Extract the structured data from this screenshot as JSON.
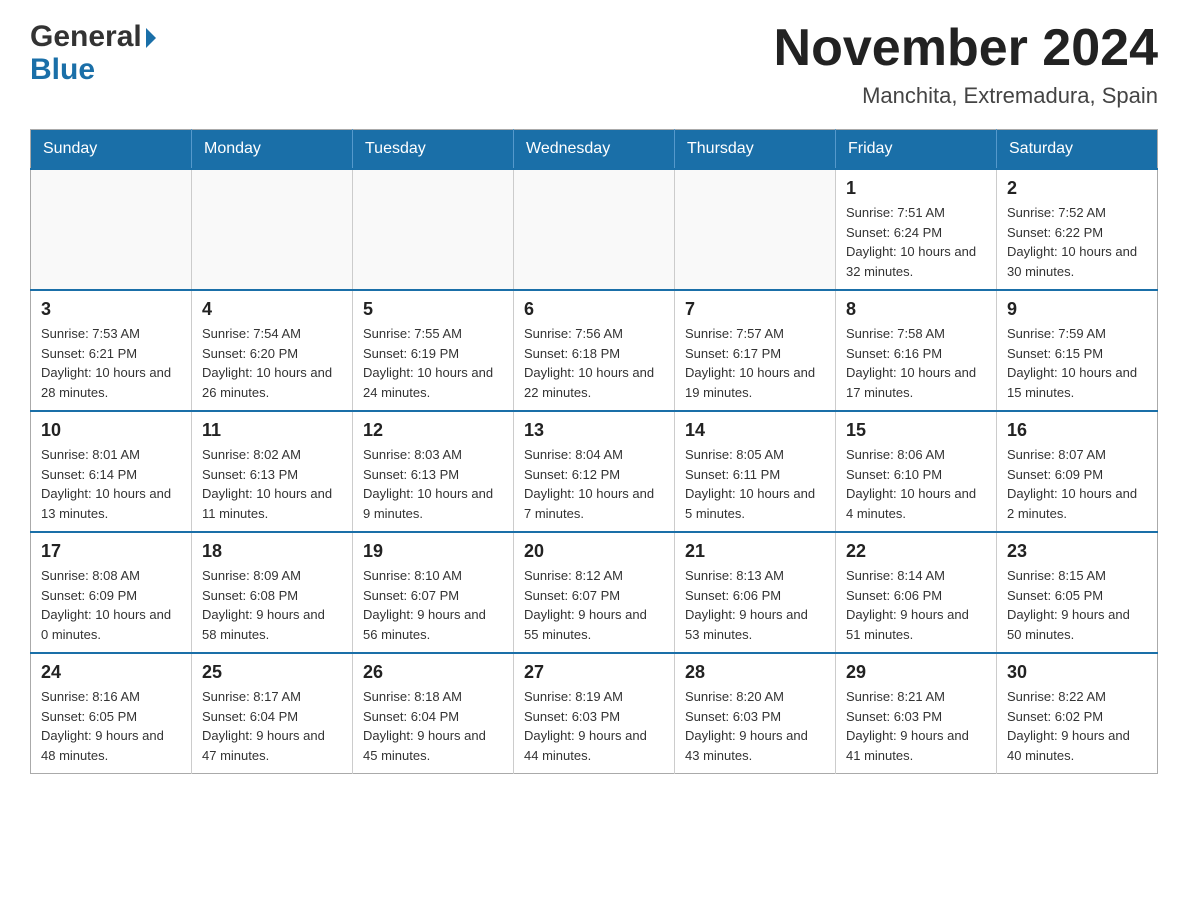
{
  "logo": {
    "general": "General",
    "blue": "Blue",
    "arrow": "▶"
  },
  "header": {
    "title": "November 2024",
    "subtitle": "Manchita, Extremadura, Spain"
  },
  "weekdays": [
    "Sunday",
    "Monday",
    "Tuesday",
    "Wednesday",
    "Thursday",
    "Friday",
    "Saturday"
  ],
  "weeks": [
    [
      {
        "day": "",
        "info": ""
      },
      {
        "day": "",
        "info": ""
      },
      {
        "day": "",
        "info": ""
      },
      {
        "day": "",
        "info": ""
      },
      {
        "day": "",
        "info": ""
      },
      {
        "day": "1",
        "info": "Sunrise: 7:51 AM\nSunset: 6:24 PM\nDaylight: 10 hours and 32 minutes."
      },
      {
        "day": "2",
        "info": "Sunrise: 7:52 AM\nSunset: 6:22 PM\nDaylight: 10 hours and 30 minutes."
      }
    ],
    [
      {
        "day": "3",
        "info": "Sunrise: 7:53 AM\nSunset: 6:21 PM\nDaylight: 10 hours and 28 minutes."
      },
      {
        "day": "4",
        "info": "Sunrise: 7:54 AM\nSunset: 6:20 PM\nDaylight: 10 hours and 26 minutes."
      },
      {
        "day": "5",
        "info": "Sunrise: 7:55 AM\nSunset: 6:19 PM\nDaylight: 10 hours and 24 minutes."
      },
      {
        "day": "6",
        "info": "Sunrise: 7:56 AM\nSunset: 6:18 PM\nDaylight: 10 hours and 22 minutes."
      },
      {
        "day": "7",
        "info": "Sunrise: 7:57 AM\nSunset: 6:17 PM\nDaylight: 10 hours and 19 minutes."
      },
      {
        "day": "8",
        "info": "Sunrise: 7:58 AM\nSunset: 6:16 PM\nDaylight: 10 hours and 17 minutes."
      },
      {
        "day": "9",
        "info": "Sunrise: 7:59 AM\nSunset: 6:15 PM\nDaylight: 10 hours and 15 minutes."
      }
    ],
    [
      {
        "day": "10",
        "info": "Sunrise: 8:01 AM\nSunset: 6:14 PM\nDaylight: 10 hours and 13 minutes."
      },
      {
        "day": "11",
        "info": "Sunrise: 8:02 AM\nSunset: 6:13 PM\nDaylight: 10 hours and 11 minutes."
      },
      {
        "day": "12",
        "info": "Sunrise: 8:03 AM\nSunset: 6:13 PM\nDaylight: 10 hours and 9 minutes."
      },
      {
        "day": "13",
        "info": "Sunrise: 8:04 AM\nSunset: 6:12 PM\nDaylight: 10 hours and 7 minutes."
      },
      {
        "day": "14",
        "info": "Sunrise: 8:05 AM\nSunset: 6:11 PM\nDaylight: 10 hours and 5 minutes."
      },
      {
        "day": "15",
        "info": "Sunrise: 8:06 AM\nSunset: 6:10 PM\nDaylight: 10 hours and 4 minutes."
      },
      {
        "day": "16",
        "info": "Sunrise: 8:07 AM\nSunset: 6:09 PM\nDaylight: 10 hours and 2 minutes."
      }
    ],
    [
      {
        "day": "17",
        "info": "Sunrise: 8:08 AM\nSunset: 6:09 PM\nDaylight: 10 hours and 0 minutes."
      },
      {
        "day": "18",
        "info": "Sunrise: 8:09 AM\nSunset: 6:08 PM\nDaylight: 9 hours and 58 minutes."
      },
      {
        "day": "19",
        "info": "Sunrise: 8:10 AM\nSunset: 6:07 PM\nDaylight: 9 hours and 56 minutes."
      },
      {
        "day": "20",
        "info": "Sunrise: 8:12 AM\nSunset: 6:07 PM\nDaylight: 9 hours and 55 minutes."
      },
      {
        "day": "21",
        "info": "Sunrise: 8:13 AM\nSunset: 6:06 PM\nDaylight: 9 hours and 53 minutes."
      },
      {
        "day": "22",
        "info": "Sunrise: 8:14 AM\nSunset: 6:06 PM\nDaylight: 9 hours and 51 minutes."
      },
      {
        "day": "23",
        "info": "Sunrise: 8:15 AM\nSunset: 6:05 PM\nDaylight: 9 hours and 50 minutes."
      }
    ],
    [
      {
        "day": "24",
        "info": "Sunrise: 8:16 AM\nSunset: 6:05 PM\nDaylight: 9 hours and 48 minutes."
      },
      {
        "day": "25",
        "info": "Sunrise: 8:17 AM\nSunset: 6:04 PM\nDaylight: 9 hours and 47 minutes."
      },
      {
        "day": "26",
        "info": "Sunrise: 8:18 AM\nSunset: 6:04 PM\nDaylight: 9 hours and 45 minutes."
      },
      {
        "day": "27",
        "info": "Sunrise: 8:19 AM\nSunset: 6:03 PM\nDaylight: 9 hours and 44 minutes."
      },
      {
        "day": "28",
        "info": "Sunrise: 8:20 AM\nSunset: 6:03 PM\nDaylight: 9 hours and 43 minutes."
      },
      {
        "day": "29",
        "info": "Sunrise: 8:21 AM\nSunset: 6:03 PM\nDaylight: 9 hours and 41 minutes."
      },
      {
        "day": "30",
        "info": "Sunrise: 8:22 AM\nSunset: 6:02 PM\nDaylight: 9 hours and 40 minutes."
      }
    ]
  ]
}
